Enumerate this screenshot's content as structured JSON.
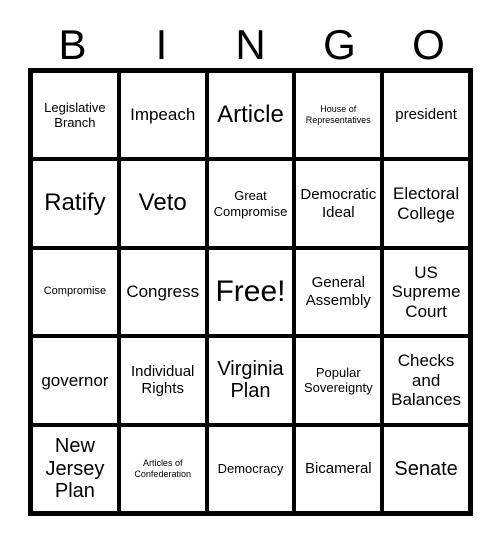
{
  "card": {
    "title": "BINGO Card",
    "header_letters": [
      "B",
      "I",
      "N",
      "G",
      "O"
    ],
    "colors": {
      "background": "#ffffff",
      "border": "#000000",
      "text": "#000000"
    },
    "grid": {
      "rows": 5,
      "columns": 5,
      "free_space_index": 12
    },
    "cells": [
      {
        "text": "Legislative Branch",
        "size": "t-md"
      },
      {
        "text": "Impeach",
        "size": "t-xl"
      },
      {
        "text": "Article",
        "size": "t-3xl"
      },
      {
        "text": "House of Representatives",
        "size": "t-xs"
      },
      {
        "text": "president",
        "size": "t-lg"
      },
      {
        "text": "Ratify",
        "size": "t-3xl"
      },
      {
        "text": "Veto",
        "size": "t-3xl"
      },
      {
        "text": "Great Compromise",
        "size": "t-md"
      },
      {
        "text": "Democratic Ideal",
        "size": "t-lg"
      },
      {
        "text": "Electoral College",
        "size": "t-xl"
      },
      {
        "text": "Compromise",
        "size": "t-sm"
      },
      {
        "text": "Congress",
        "size": "t-xl"
      },
      {
        "text": "Free!",
        "size": "t-4xl"
      },
      {
        "text": "General Assembly",
        "size": "t-lg"
      },
      {
        "text": "US Supreme Court",
        "size": "t-xl"
      },
      {
        "text": "governor",
        "size": "t-xl"
      },
      {
        "text": "Individual Rights",
        "size": "t-lg"
      },
      {
        "text": "Virginia Plan",
        "size": "t-2xl"
      },
      {
        "text": "Popular Sovereignty",
        "size": "t-md"
      },
      {
        "text": "Checks and Balances",
        "size": "t-xl"
      },
      {
        "text": "New Jersey Plan",
        "size": "t-2xl"
      },
      {
        "text": "Articles of Confederation",
        "size": "t-xs"
      },
      {
        "text": "Democracy",
        "size": "t-md"
      },
      {
        "text": "Bicameral",
        "size": "t-lg"
      },
      {
        "text": "Senate",
        "size": "t-2xl"
      }
    ]
  }
}
